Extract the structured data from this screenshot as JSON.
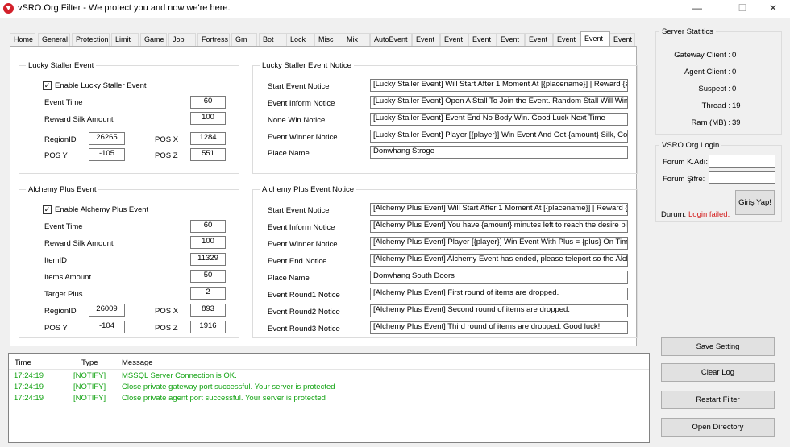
{
  "window": {
    "title": "vSRO.Org Filter - We protect you and now we're here.",
    "minimize_glyph": "—",
    "maximize_glyph": "☐",
    "close_glyph": "✕"
  },
  "tabs": [
    "Home",
    "General",
    "Protection",
    "Limit",
    "Game",
    "Job",
    "Fortress",
    "Gm",
    "Bot",
    "Lock",
    "Misc",
    "Mix",
    "AutoEvent",
    "Event",
    "Event",
    "Event",
    "Event",
    "Event",
    "Event",
    "Event",
    "Event"
  ],
  "active_tab_index": 19,
  "lucky": {
    "title": "Lucky Staller Event",
    "enable_label": "Enable Lucky Staller Event",
    "enabled": true,
    "event_time_label": "Event Time",
    "event_time": "60",
    "reward_label": "Reward Silk  Amount",
    "reward": "100",
    "region_label": "RegionID",
    "region": "26265",
    "posx_label": "POS X",
    "posx": "1284",
    "posy_label": "POS Y",
    "posy": "-105",
    "posz_label": "POS Z",
    "posz": "551"
  },
  "lucky_notice": {
    "title": "Lucky Staller Event Notice",
    "rows": [
      {
        "label": "Start Event Notice",
        "value": "[Lucky Staller Event] Will Start After 1 Moment At [{placename}] | Reward {amou"
      },
      {
        "label": "Event Inform Notice",
        "value": "[Lucky Staller Event] Open A Stall To Join the Event. Random Stall Will Win Eve"
      },
      {
        "label": "None Win Notice",
        "value": "[Lucky Staller Event] Event End No Body Win. Good Luck Next Time"
      },
      {
        "label": "Event Winner Notice",
        "value": "[Lucky Staller Event] Player [{player}] Win Event And Get {amount} Silk, Congrat"
      },
      {
        "label": "Place Name",
        "value": "Donwhang Stroge"
      }
    ]
  },
  "alchemy": {
    "title": "Alchemy Plus Event",
    "enable_label": "Enable Alchemy Plus Event",
    "enabled": true,
    "event_time_label": "Event Time",
    "event_time": "60",
    "reward_label": "Reward Silk  Amount",
    "reward": "100",
    "itemid_label": "ItemID",
    "itemid": "11329",
    "items_amount_label": "Items  Amount",
    "items_amount": "50",
    "target_plus_label": "Target Plus",
    "target_plus": "2",
    "region_label": "RegionID",
    "region": "26009",
    "posx_label": "POS X",
    "posx": "893",
    "posy_label": "POS Y",
    "posy": "-104",
    "posz_label": "POS Z",
    "posz": "1916"
  },
  "alchemy_notice": {
    "title": "Alchemy Plus Event Notice",
    "rows": [
      {
        "label": "Start Event Notice",
        "value": "[Alchemy Plus Event] Will Start After 1 Moment At [{placename}] | Reward {amou"
      },
      {
        "label": "Event Inform Notice",
        "value": "[Alchemy Plus Event] You have {amount} minutes left to reach the desire plus be"
      },
      {
        "label": "Event Winner Notice",
        "value": "[Alchemy Plus Event] Player [{player}] Win Event With Plus = {plus} On Time = {t"
      },
      {
        "label": "Event End Notice",
        "value": "[Alchemy Plus Event] Alchemy Event has ended, please teleport so the Alchemy"
      },
      {
        "label": "Place Name",
        "value": "Donwhang South Doors"
      },
      {
        "label": "Event Round1 Notice",
        "value": "[Alchemy Plus Event] First round of items are dropped."
      },
      {
        "label": "Event Round2 Notice",
        "value": "[Alchemy Plus Event] Second round of items are dropped."
      },
      {
        "label": "Event Round3 Notice",
        "value": "[Alchemy Plus Event] Third round of items are dropped. Good luck!"
      }
    ]
  },
  "server_stats": {
    "title": "Server Statitics",
    "rows": [
      {
        "label": "Gateway Client :",
        "value": "0"
      },
      {
        "label": "Agent Client :",
        "value": "0"
      },
      {
        "label": "Suspect :",
        "value": "0"
      },
      {
        "label": "Thread :",
        "value": "19"
      },
      {
        "label": "Ram (MB) :",
        "value": "39"
      }
    ]
  },
  "login": {
    "title": "VSRO.Org Login",
    "user_label": "Forum K.Adı:",
    "user_value": "",
    "pass_label": "Forum Şifre:",
    "pass_value": "",
    "button_label": "Giriş Yap!",
    "status_label": "Durum:",
    "status_value": "Login failed.",
    "status_color": "#d42020"
  },
  "log": {
    "headers": [
      "Time",
      "Type",
      "Message"
    ],
    "rows": [
      {
        "time": "17:24:19",
        "type": "[NOTIFY]",
        "message": "MSSQL Server Connection is OK."
      },
      {
        "time": "17:24:19",
        "type": "[NOTIFY]",
        "message": "Close private gateway port successful. Your server is protected"
      },
      {
        "time": "17:24:19",
        "type": "[NOTIFY]",
        "message": "Close private agent port successful. Your server is protected"
      }
    ],
    "text_color": "#13a313"
  },
  "actions": {
    "save": "Save Setting",
    "clear": "Clear Log",
    "restart": "Restart Filter",
    "open": "Open Directory"
  }
}
